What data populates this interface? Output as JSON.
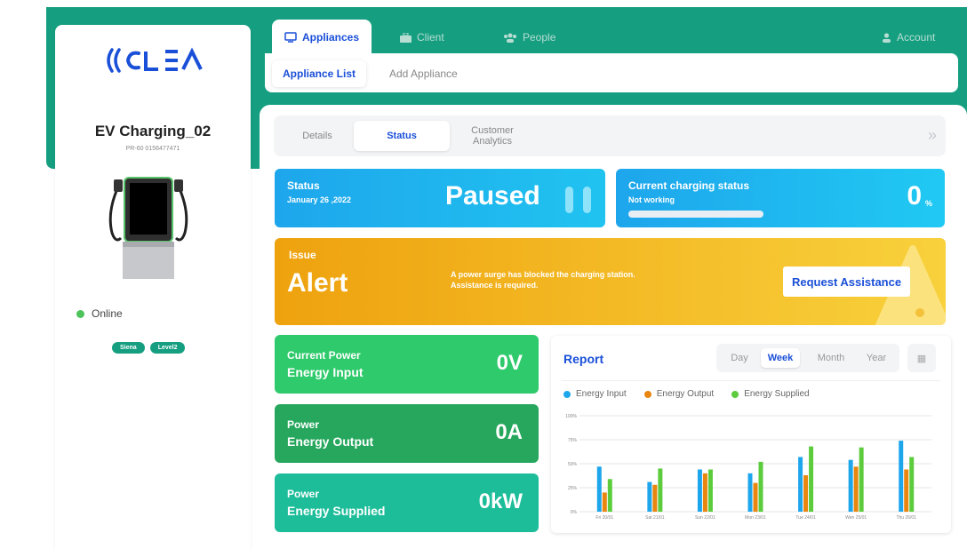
{
  "brand": {
    "logo_text": "(CLEA"
  },
  "device": {
    "name": "EV Charging_02",
    "id": "PR-60 0156477471",
    "status": "Online",
    "tags": [
      "Siena",
      "Level2"
    ]
  },
  "top_tabs": [
    {
      "label": "Appliances",
      "icon": "monitor-icon"
    },
    {
      "label": "Client",
      "icon": "briefcase-icon"
    },
    {
      "label": "People",
      "icon": "people-icon"
    },
    {
      "label": "Account",
      "icon": "user-icon"
    }
  ],
  "sub_tabs": [
    "Appliance List",
    "Add Appliance"
  ],
  "inner_tabs": [
    "Details",
    "Status",
    "Customer",
    "Analytics"
  ],
  "status_card": {
    "title": "Status",
    "date": "January 26 ,2022",
    "value": "Paused"
  },
  "charging_card": {
    "title": "Current charging status",
    "subtitle": "Not working",
    "value": "0",
    "unit": "%",
    "progress": 0
  },
  "alert_card": {
    "label": "Issue",
    "title": "Alert",
    "message_1": "A power surge has blocked the charging station.",
    "message_2": "Assistance is required.",
    "button": "Request Assistance"
  },
  "power_cards": [
    {
      "line1": "Current Power",
      "line2": "Energy Input",
      "value": "0V"
    },
    {
      "line1": "Power",
      "line2": "Energy Output",
      "value": "0A"
    },
    {
      "line1": "Power",
      "line2": "Energy Supplied",
      "value": "0kW"
    }
  ],
  "report": {
    "title": "Report",
    "periods": [
      "Day",
      "Week",
      "Month",
      "Year"
    ],
    "active_period": "Week"
  },
  "colors": {
    "input": "#1ea6ec",
    "output": "#e8860f",
    "supplied": "#5ccc3c",
    "accent": "#1a4fd8",
    "brand": "#159f80"
  },
  "chart_data": {
    "type": "bar",
    "categories": [
      "Fri 20/01",
      "Sat 21/01",
      "Sun 22/01",
      "Mon 23/01",
      "Tue 24/01",
      "Wen 25/01",
      "Thu 26/01"
    ],
    "yticks": [
      "0%",
      "25%",
      "50%",
      "75%",
      "100%"
    ],
    "ylim": [
      0,
      100
    ],
    "series": [
      {
        "name": "Energy Input",
        "values": [
          47,
          31,
          44,
          40,
          57,
          54,
          74
        ]
      },
      {
        "name": "Energy Output",
        "values": [
          20,
          28,
          40,
          30,
          38,
          47,
          44
        ]
      },
      {
        "name": "Energy Supplied",
        "values": [
          34,
          45,
          44,
          52,
          68,
          67,
          57
        ]
      }
    ],
    "legend": "top-left",
    "grid": true
  }
}
